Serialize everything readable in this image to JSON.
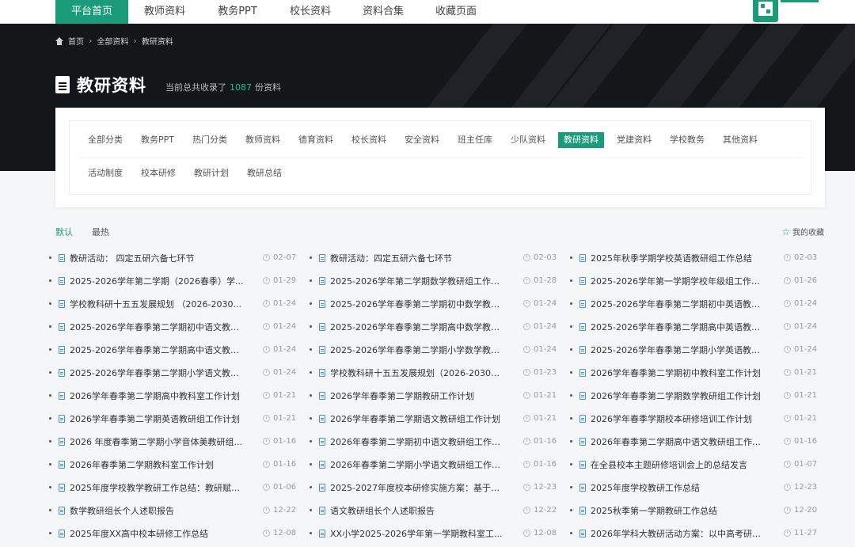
{
  "nav": {
    "items": [
      {
        "label": "平台首页",
        "active": true
      },
      {
        "label": "教师资料",
        "active": false
      },
      {
        "label": "教务PPT",
        "active": false
      },
      {
        "label": "校长资料",
        "active": false
      },
      {
        "label": "资料合集",
        "active": false
      },
      {
        "label": "收藏页面",
        "active": false
      }
    ]
  },
  "breadcrumb": {
    "home": "首页",
    "level1": "全部资料",
    "level2": "教研资料"
  },
  "header": {
    "title": "教研资料",
    "count_prefix": "当前总共收录了",
    "count": "1087",
    "count_suffix": "份资料"
  },
  "filters": {
    "row1": [
      "全部分类",
      "教务PPT",
      "热门分类",
      "教师资料",
      "德育资料",
      "校长资料",
      "安全资料",
      "班主任库",
      "少队资料",
      "教研资料",
      "党建资料",
      "学校教务",
      "其他资料"
    ],
    "row2": [
      "活动制度",
      "校本研修",
      "教研计划",
      "教研总结"
    ],
    "active": "教研资料"
  },
  "tabs": {
    "items": [
      "默认",
      "最热"
    ],
    "active": "默认"
  },
  "favorites": {
    "label": "我的收藏"
  },
  "colors": {
    "accent": "#1a9c7b",
    "banner": "#14171a",
    "count": "#1fbf93"
  },
  "list": [
    {
      "title": "教研活动：  四定五研六备七环节",
      "date": "02-07"
    },
    {
      "title": "教研活动：四定五研六备七环节",
      "date": "02-03"
    },
    {
      "title": "2025年秋季学期学校英语教研组工作总结",
      "date": "02-03"
    },
    {
      "title": "2025-2026学年第二学期（2026春季）学...",
      "date": "01-29"
    },
    {
      "title": "2025-2026学年第二学期数学教研组工作计...",
      "date": "01-28"
    },
    {
      "title": "2025-2026学年第一学期学校年级组工作总结...",
      "date": "01-26"
    },
    {
      "title": "学校教科研十五五发展规划 （2026-2030...",
      "date": "01-24"
    },
    {
      "title": "2025-2026学年春季第二学期初中数学教研...",
      "date": "01-24"
    },
    {
      "title": "2025-2026学年春季第二学期初中英语教研...",
      "date": "01-24"
    },
    {
      "title": "2025-2026学年春季第二学期初中语文教研...",
      "date": "01-24"
    },
    {
      "title": "2025-2026学年春季第二学期高中数学教研...",
      "date": "01-24"
    },
    {
      "title": "2025-2026学年春季第二学期高中英语教研...",
      "date": "01-24"
    },
    {
      "title": "2025-2026学年春季第二学期高中语文教研...",
      "date": "01-24"
    },
    {
      "title": "2025-2026学年春季第二学期小学数学教研...",
      "date": "01-24"
    },
    {
      "title": "2025-2026学年春季第二学期小学英语教研...",
      "date": "01-24"
    },
    {
      "title": "2025-2026学年春季第二学期小学语文教研...",
      "date": "01-24"
    },
    {
      "title": "学校教科研十五五发展规划（2026-2030年...",
      "date": "01-23"
    },
    {
      "title": "2026学年春季第二学期初中教科室工作计划",
      "date": "01-21"
    },
    {
      "title": "2026学年春季第二学期高中教科室工作计划",
      "date": "01-21"
    },
    {
      "title": "2026学年春季第二学期教研工作计划",
      "date": "01-21"
    },
    {
      "title": "2026学年春季第二学期数学教研组工作计划",
      "date": "01-21"
    },
    {
      "title": "2026学年春季第二学期英语教研组工作计划",
      "date": "01-21"
    },
    {
      "title": "2026学年春季第二学期语文教研组工作计划",
      "date": "01-21"
    },
    {
      "title": "2026学年春季学期校本研修培训工作计划",
      "date": "01-21"
    },
    {
      "title": "2026 年度春季第二学期小学音体美教研组...",
      "date": "01-16"
    },
    {
      "title": "2026年春季第二学期初中语文教研组工作计...",
      "date": "01-16"
    },
    {
      "title": "2026年春季第二学期高中语文教研组工作计...",
      "date": "01-16"
    },
    {
      "title": "2026年春季第二学期教科室工作计划",
      "date": "01-16"
    },
    {
      "title": "2026年春季第二学期小学语文教研组工作计...",
      "date": "01-16"
    },
    {
      "title": "在全县校本主题研修培训会上的总结发言",
      "date": "01-07"
    },
    {
      "title": "2025年度学校教学教研工作总结：教研赋能...",
      "date": "01-06"
    },
    {
      "title": "2025-2027年度校本研修实施方案：基于教...",
      "date": "12-23"
    },
    {
      "title": "2025年度学校教研工作总结",
      "date": "12-23"
    },
    {
      "title": "数学教研组长个人述职报告",
      "date": "12-22"
    },
    {
      "title": "语文教研组长个人述职报告",
      "date": "12-22"
    },
    {
      "title": "2025秋季第一学期教研工作总结",
      "date": "12-20"
    },
    {
      "title": "2025年度XX高中校本研修工作总结",
      "date": "12-08"
    },
    {
      "title": "XX小学2025-2026学年第一学期教科室工...",
      "date": "12-08"
    },
    {
      "title": "2026年学科大教研活动方案：以中高考研究...",
      "date": "11-27"
    }
  ]
}
